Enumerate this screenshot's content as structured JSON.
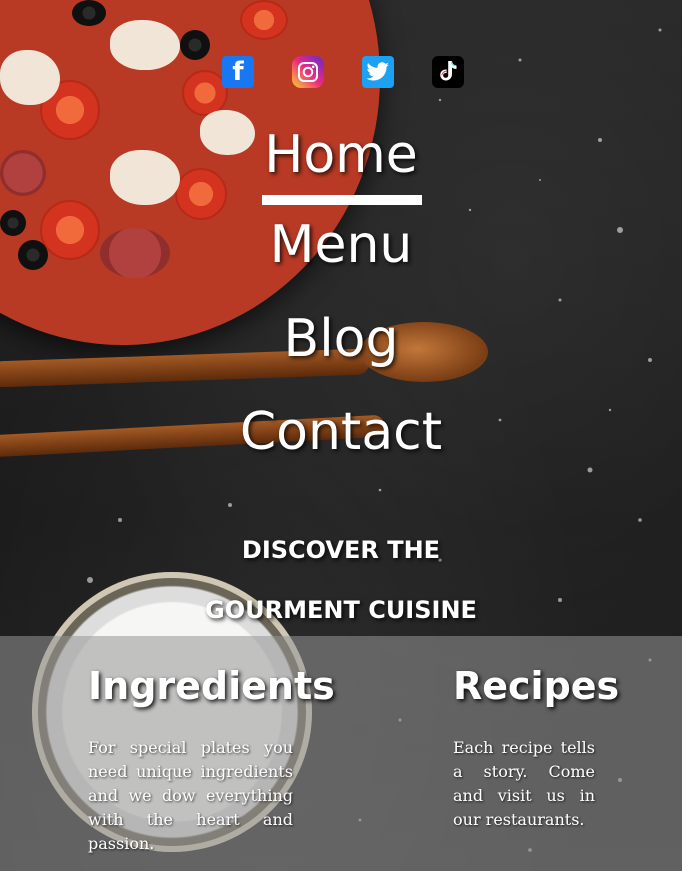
{
  "social": {
    "facebook": "facebook-icon",
    "instagram": "instagram-icon",
    "twitter": "twitter-icon",
    "tiktok": "tiktok-icon"
  },
  "nav": {
    "home": "Home",
    "menu": "Menu",
    "blog": "Blog",
    "contact": "Contact"
  },
  "hero": {
    "line1": "DISCOVER THE",
    "line2": "GOURMENT CUISINE"
  },
  "ingredients": {
    "title": "Ingredients",
    "text": "For special plates you need unique ingredients and we dow everything with the heart and passion."
  },
  "recipes": {
    "title": "Recipes",
    "text": "Each recipe tells a story. Come and visit us in our restaurants."
  },
  "colors": {
    "text": "#ffffff",
    "band": "#969696",
    "facebook": "#1877f2",
    "twitter": "#1da1f2"
  }
}
